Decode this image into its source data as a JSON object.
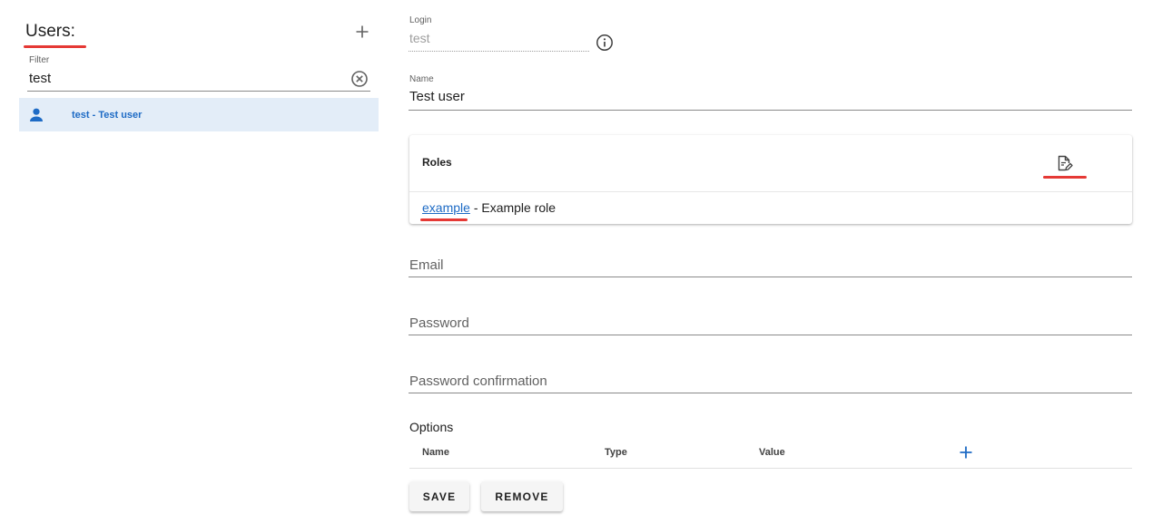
{
  "users_panel": {
    "title": "Users:",
    "filter": {
      "label": "Filter",
      "value": "test"
    },
    "list": [
      {
        "label": "test - Test user"
      }
    ]
  },
  "form": {
    "login": {
      "label": "Login",
      "value": "test"
    },
    "name": {
      "label": "Name",
      "value": "Test user"
    },
    "roles": {
      "title": "Roles",
      "items": [
        {
          "link": "example",
          "description": "- Example role"
        }
      ]
    },
    "email": {
      "placeholder": "Email"
    },
    "password": {
      "placeholder": "Password"
    },
    "password_confirmation": {
      "placeholder": "Password confirmation"
    },
    "options": {
      "title": "Options",
      "columns": [
        "Name",
        "Type",
        "Value"
      ]
    },
    "buttons": {
      "save": "SAVE",
      "remove": "REMOVE"
    }
  },
  "colors": {
    "accent": "#1e6bc5",
    "selected_bg": "#e3edf8",
    "annotation_red": "#e53935"
  },
  "icons": {
    "add_user": "plus-icon",
    "clear_filter": "clear-circle-icon",
    "user": "person-icon",
    "login_info": "info-icon",
    "edit_roles": "edit-document-icon",
    "add_option": "plus-icon"
  }
}
